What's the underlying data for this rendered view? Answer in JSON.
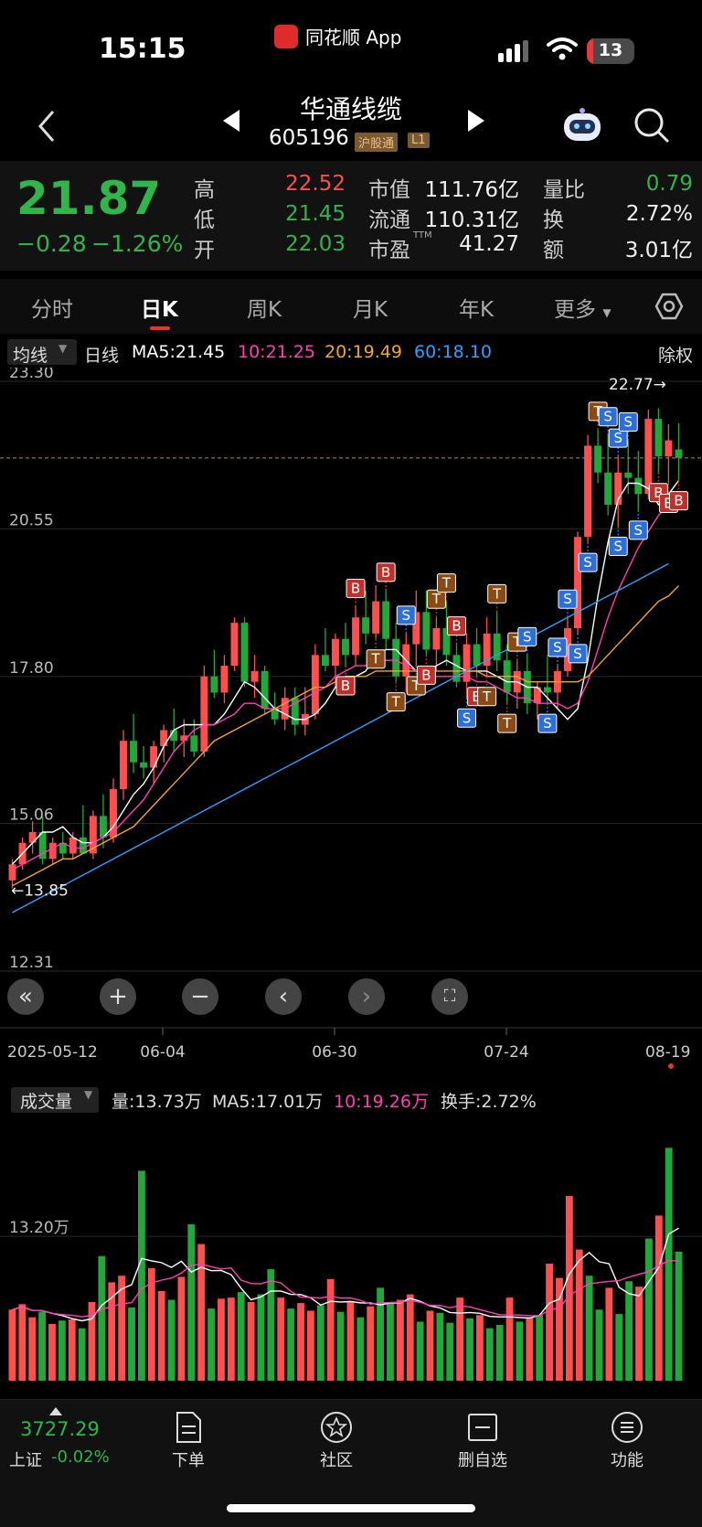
{
  "status": {
    "time": "15:15",
    "app": "同花顺 App",
    "battery": "13",
    "battery_pct": 0.13
  },
  "stock": {
    "name": "华通线缆",
    "code": "605196",
    "tag_connect": "沪股通",
    "tag_level": "L1"
  },
  "quote": {
    "price": "21.87",
    "change": "−0.28",
    "change_pct": "−1.26%",
    "labels": {
      "high": "高",
      "low": "低",
      "open": "开",
      "mcap": "市值",
      "float": "流通",
      "pe": "市盈",
      "pe_sup": "TTM",
      "volratio": "量比",
      "turnover": "换",
      "amount": "额"
    },
    "high": "22.52",
    "low": "21.45",
    "open": "22.03",
    "mcap": "111.76亿",
    "float_cap": "110.31亿",
    "pe": "41.27",
    "volratio": "0.79",
    "turnover": "2.72%",
    "amount": "3.01亿"
  },
  "tabs": [
    "分时",
    "日K",
    "周K",
    "月K",
    "年K",
    "更多"
  ],
  "active_tab": "日K",
  "legend": {
    "dropdown": "均线",
    "period": "日线",
    "ma5": "MA5:21.45",
    "ma10": "10:21.25",
    "ma20": "20:19.49",
    "ma60": "60:18.10",
    "adjust": "除权"
  },
  "colors": {
    "up": "#ff4e4e",
    "down": "#22a83a",
    "ma5": "#ffffff",
    "ma10": "#ff3fb4",
    "ma20": "#f5a623",
    "ma60": "#2ba0ff",
    "t_marker": "#8b4a14",
    "b_marker": "#c0302b",
    "s_marker": "#2c6fd6"
  },
  "chart_data": {
    "type": "candlestick",
    "y_ticks": [
      "23.30",
      "20.55",
      "17.80",
      "15.06",
      "12.31"
    ],
    "y_range": [
      12.31,
      23.3
    ],
    "x_ticks": [
      "2025-05-12",
      "06-04",
      "06-30",
      "07-24",
      "08-19"
    ],
    "max_label": "22.77→",
    "min_label": "←13.85",
    "series": [
      {
        "name": "MA5",
        "values": [
          14.3,
          14.5,
          14.7,
          14.9,
          14.9,
          15.0,
          14.8,
          14.7,
          14.7,
          14.8,
          15.0,
          15.3,
          15.6,
          15.8,
          16.1,
          16.5,
          16.8,
          16.9,
          16.9,
          16.9,
          16.9,
          17.1,
          17.4,
          17.7,
          17.6,
          17.4,
          17.2,
          17.1,
          17.0,
          17.0,
          17.1,
          17.3,
          17.6,
          17.8,
          17.8,
          17.9,
          18.2,
          18.3,
          18.3,
          18.1,
          17.9,
          17.8,
          18.0,
          18.1,
          18.0,
          17.9,
          17.9,
          17.9,
          17.8,
          17.7,
          17.7,
          17.6,
          17.6,
          17.4,
          17.2,
          17.0,
          17.2,
          18.1,
          19.3,
          20.3,
          21.1,
          21.4,
          21.4,
          21.3,
          21.0,
          21.2,
          21.45
        ]
      },
      {
        "name": "MA10",
        "values": [
          14.2,
          14.3,
          14.4,
          14.5,
          14.6,
          14.7,
          14.6,
          14.6,
          14.7,
          14.8,
          14.9,
          15.1,
          15.3,
          15.5,
          15.8,
          16.1,
          16.4,
          16.6,
          16.8,
          16.9,
          16.9,
          17.0,
          17.1,
          17.3,
          17.3,
          17.2,
          17.2,
          17.2,
          17.3,
          17.4,
          17.5,
          17.6,
          17.8,
          17.9,
          18.0,
          18.0,
          18.1,
          18.1,
          18.1,
          18.0,
          17.9,
          17.8,
          17.8,
          17.8,
          17.8,
          17.8,
          17.7,
          17.7,
          17.6,
          17.5,
          17.4,
          17.4,
          17.3,
          17.3,
          17.3,
          17.2,
          17.3,
          17.7,
          18.3,
          18.9,
          19.4,
          19.8,
          20.2,
          20.5,
          20.8,
          21.0,
          21.25
        ]
      },
      {
        "name": "MA20",
        "values": [
          13.9,
          14.0,
          14.1,
          14.2,
          14.3,
          14.4,
          14.4,
          14.5,
          14.6,
          14.7,
          14.8,
          14.9,
          15.0,
          15.2,
          15.4,
          15.6,
          15.8,
          16.0,
          16.2,
          16.4,
          16.6,
          16.7,
          16.8,
          16.9,
          17.0,
          17.1,
          17.2,
          17.3,
          17.4,
          17.5,
          17.6,
          17.6,
          17.7,
          17.7,
          17.8,
          17.8,
          17.9,
          17.9,
          17.9,
          17.9,
          17.9,
          17.9,
          17.9,
          17.9,
          17.9,
          17.9,
          17.9,
          17.8,
          17.8,
          17.8,
          17.8,
          17.7,
          17.7,
          17.7,
          17.7,
          17.7,
          17.7,
          17.8,
          18.0,
          18.2,
          18.4,
          18.6,
          18.8,
          19.0,
          19.2,
          19.3,
          19.49
        ]
      },
      {
        "name": "MA60",
        "values": [
          13.4,
          13.5,
          13.6,
          13.7,
          13.8,
          13.9,
          14.0,
          14.1,
          14.2,
          14.3,
          14.4,
          14.5,
          14.6,
          14.7,
          14.8,
          14.9,
          15.0,
          15.1,
          15.2,
          15.3,
          15.4,
          15.5,
          15.6,
          15.7,
          15.8,
          15.9,
          16.0,
          16.1,
          16.2,
          16.3,
          16.4,
          16.5,
          16.6,
          16.7,
          16.8,
          16.9,
          17.0,
          17.1,
          17.2,
          17.3,
          17.4,
          17.5,
          17.6,
          17.7,
          17.8,
          17.9,
          18.0,
          18.1,
          18.2,
          18.3,
          18.4,
          18.5,
          18.6,
          18.7,
          18.8,
          18.9,
          19.0,
          19.1,
          19.2,
          19.3,
          19.4,
          19.5,
          19.6,
          19.7,
          19.8,
          19.9,
          18.1
        ]
      }
    ],
    "ohlc": [
      [
        14.0,
        14.4,
        13.85,
        14.3
      ],
      [
        14.3,
        14.8,
        14.2,
        14.7
      ],
      [
        14.7,
        15.1,
        14.5,
        14.9
      ],
      [
        14.9,
        15.2,
        14.3,
        14.4
      ],
      [
        14.4,
        14.8,
        14.3,
        14.7
      ],
      [
        14.7,
        14.9,
        14.4,
        14.5
      ],
      [
        14.5,
        14.9,
        14.4,
        14.8
      ],
      [
        14.8,
        15.4,
        14.6,
        14.5
      ],
      [
        14.5,
        15.3,
        14.4,
        15.2
      ],
      [
        15.2,
        15.6,
        14.6,
        14.8
      ],
      [
        14.8,
        15.9,
        14.7,
        15.7
      ],
      [
        15.7,
        16.8,
        15.5,
        16.6
      ],
      [
        16.6,
        17.1,
        16.0,
        16.2
      ],
      [
        16.2,
        16.5,
        15.9,
        16.1
      ],
      [
        16.1,
        16.6,
        15.8,
        16.5
      ],
      [
        16.5,
        16.9,
        16.2,
        16.8
      ],
      [
        16.8,
        17.2,
        16.4,
        16.6
      ],
      [
        16.6,
        17.0,
        16.3,
        16.7
      ],
      [
        16.7,
        17.0,
        16.3,
        16.4
      ],
      [
        16.4,
        18.0,
        16.3,
        17.8
      ],
      [
        17.8,
        18.3,
        17.4,
        17.5
      ],
      [
        17.5,
        18.2,
        17.3,
        18.0
      ],
      [
        18.0,
        18.9,
        17.9,
        18.8
      ],
      [
        18.8,
        18.9,
        17.6,
        17.7
      ],
      [
        17.7,
        18.2,
        17.4,
        17.9
      ],
      [
        17.9,
        18.0,
        17.1,
        17.2
      ],
      [
        17.2,
        17.5,
        16.9,
        17.0
      ],
      [
        17.0,
        17.6,
        16.8,
        17.4
      ],
      [
        17.4,
        17.6,
        16.7,
        16.9
      ],
      [
        16.9,
        17.6,
        16.7,
        17.1
      ],
      [
        17.1,
        18.4,
        17.0,
        18.2
      ],
      [
        18.2,
        18.7,
        17.9,
        18.0
      ],
      [
        18.0,
        18.6,
        17.6,
        18.5
      ],
      [
        18.5,
        18.8,
        18.0,
        18.2
      ],
      [
        18.2,
        19.1,
        18.0,
        18.9
      ],
      [
        18.9,
        19.4,
        18.4,
        18.6
      ],
      [
        18.6,
        19.5,
        18.5,
        19.2
      ],
      [
        19.2,
        19.4,
        18.3,
        18.5
      ],
      [
        18.5,
        18.8,
        17.7,
        17.8
      ],
      [
        17.8,
        18.6,
        17.5,
        18.4
      ],
      [
        18.4,
        19.4,
        18.0,
        19.0
      ],
      [
        19.0,
        19.4,
        18.2,
        18.3
      ],
      [
        18.3,
        18.9,
        17.9,
        18.7
      ],
      [
        18.7,
        19.2,
        18.0,
        18.2
      ],
      [
        18.2,
        18.4,
        17.6,
        17.7
      ],
      [
        17.7,
        18.6,
        17.4,
        18.4
      ],
      [
        18.4,
        18.7,
        17.8,
        18.0
      ],
      [
        18.0,
        18.9,
        17.8,
        18.6
      ],
      [
        18.6,
        19.0,
        17.9,
        18.1
      ],
      [
        18.1,
        18.4,
        17.3,
        17.5
      ],
      [
        17.5,
        18.1,
        17.2,
        17.9
      ],
      [
        17.9,
        18.2,
        17.1,
        17.3
      ],
      [
        17.3,
        17.7,
        17.0,
        17.6
      ],
      [
        17.6,
        18.2,
        17.3,
        17.5
      ],
      [
        17.5,
        18.0,
        17.2,
        17.9
      ],
      [
        17.9,
        18.9,
        17.8,
        18.7
      ],
      [
        18.7,
        20.5,
        18.6,
        20.4
      ],
      [
        20.4,
        22.3,
        20.3,
        22.1
      ],
      [
        22.1,
        22.4,
        21.4,
        21.6
      ],
      [
        21.6,
        22.3,
        20.8,
        21.0
      ],
      [
        21.0,
        21.9,
        20.6,
        21.6
      ],
      [
        21.6,
        22.2,
        21.2,
        21.5
      ],
      [
        21.5,
        22.0,
        20.9,
        21.2
      ],
      [
        21.2,
        22.77,
        21.1,
        22.6
      ],
      [
        22.6,
        22.8,
        21.6,
        21.9
      ],
      [
        21.9,
        22.5,
        21.4,
        22.2
      ],
      [
        22.03,
        22.52,
        21.45,
        21.87
      ]
    ],
    "markers": [
      {
        "i": 34,
        "type": "B",
        "pos": "above"
      },
      {
        "i": 37,
        "type": "B",
        "pos": "above"
      },
      {
        "i": 39,
        "type": "S",
        "pos": "above"
      },
      {
        "i": 33,
        "type": "B",
        "pos": "below"
      },
      {
        "i": 36,
        "type": "T",
        "pos": "below"
      },
      {
        "i": 38,
        "type": "T",
        "pos": "below"
      },
      {
        "i": 40,
        "type": "T",
        "pos": "below"
      },
      {
        "i": 41,
        "type": "B",
        "pos": "below"
      },
      {
        "i": 42,
        "type": "T",
        "pos": "above"
      },
      {
        "i": 43,
        "type": "T",
        "pos": "above"
      },
      {
        "i": 44,
        "type": "B",
        "pos": "above"
      },
      {
        "i": 45,
        "type": "S",
        "pos": "below"
      },
      {
        "i": 46,
        "type": "B",
        "pos": "below"
      },
      {
        "i": 47,
        "type": "T",
        "pos": "below"
      },
      {
        "i": 48,
        "type": "T",
        "pos": "above"
      },
      {
        "i": 49,
        "type": "T",
        "pos": "below"
      },
      {
        "i": 50,
        "type": "T",
        "pos": "above"
      },
      {
        "i": 51,
        "type": "S",
        "pos": "above"
      },
      {
        "i": 53,
        "type": "S",
        "pos": "below"
      },
      {
        "i": 54,
        "type": "S",
        "pos": "above"
      },
      {
        "i": 55,
        "type": "S",
        "pos": "above"
      },
      {
        "i": 56,
        "type": "S",
        "pos": "below"
      },
      {
        "i": 57,
        "type": "S",
        "pos": "below"
      },
      {
        "i": 58,
        "type": "T",
        "pos": "above"
      },
      {
        "i": 59,
        "type": "S",
        "pos": "above"
      },
      {
        "i": 60,
        "type": "S",
        "pos": "above"
      },
      {
        "i": 61,
        "type": "S",
        "pos": "above"
      },
      {
        "i": 62,
        "type": "S",
        "pos": "below"
      },
      {
        "i": 64,
        "type": "B",
        "pos": "below"
      },
      {
        "i": 65,
        "type": "B",
        "pos": "below"
      },
      {
        "i": 66,
        "type": "B",
        "pos": "below"
      },
      {
        "i": 60,
        "type": "S",
        "pos": "below"
      }
    ],
    "volume": {
      "y_tick": "13.20万",
      "values": [
        6.5,
        7.0,
        5.8,
        6.3,
        5.2,
        5.5,
        5.6,
        4.8,
        7.2,
        11.4,
        9.0,
        9.6,
        6.7,
        19.2,
        10.3,
        8.2,
        7.4,
        9.5,
        14.3,
        12.5,
        6.6,
        7.5,
        7.6,
        8.1,
        7.2,
        7.9,
        10.2,
        7.6,
        6.6,
        7.1,
        6.4,
        6.9,
        9.3,
        6.3,
        7.3,
        5.8,
        6.8,
        8.5,
        7.1,
        7.4,
        7.9,
        5.4,
        6.4,
        6.2,
        5.3,
        7.6,
        5.7,
        6.0,
        4.8,
        5.1,
        7.6,
        5.4,
        5.8,
        6.0,
        10.7,
        9.4,
        16.9,
        12.0,
        9.6,
        6.5,
        8.5,
        6.1,
        9.1,
        8.6,
        13.0,
        15.1,
        21.3,
        11.8
      ]
    }
  },
  "volume_head": {
    "dropdown": "成交量",
    "vol": "量:13.73万",
    "ma5": "MA5:17.01万",
    "ma10": "10:19.26万",
    "turnover": "换手:2.72%"
  },
  "index": {
    "value": "3727.29",
    "name": "上证",
    "change": "-0.02%"
  },
  "bottom_nav": [
    "下单",
    "社区",
    "删自选",
    "功能"
  ]
}
